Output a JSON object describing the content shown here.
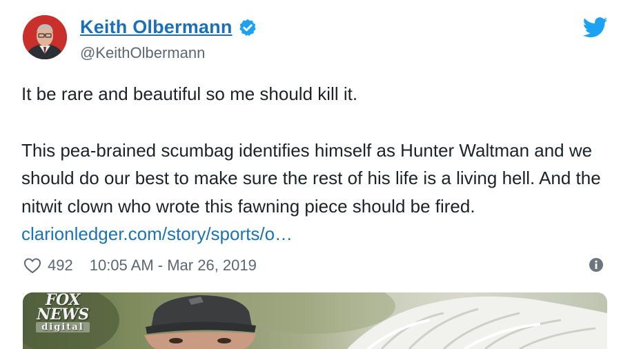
{
  "tweet": {
    "author": {
      "display_name": "Keith Olbermann",
      "handle": "@KeithOlbermann",
      "verified": true
    },
    "body": {
      "paragraph1": "It be rare and beautiful so me should kill it.",
      "paragraph2_text": "This pea-brained scumbag identifies himself as Hunter Waltman and we should do our best to make sure the rest of his life is a living hell. And the nitwit clown who wrote this fawning piece should be fired.",
      "link": "clarionledger.com/story/sports/o…"
    },
    "meta": {
      "likes": "492",
      "timestamp": "10:05 AM - Mar 26, 2019"
    },
    "media": {
      "watermark_line1": "FOX",
      "watermark_line2": "NEWS",
      "watermark_line3": "digital"
    }
  },
  "icons": {
    "verified": "verified-badge-icon",
    "brand": "twitter-bird-icon",
    "like": "heart-icon",
    "info": "info-icon"
  },
  "colors": {
    "name_link": "#1b6fb8",
    "body_link": "#1b73b3",
    "verified_blue": "#1da1f2",
    "secondary_text": "#5b6670",
    "body_text": "#1c2226"
  }
}
